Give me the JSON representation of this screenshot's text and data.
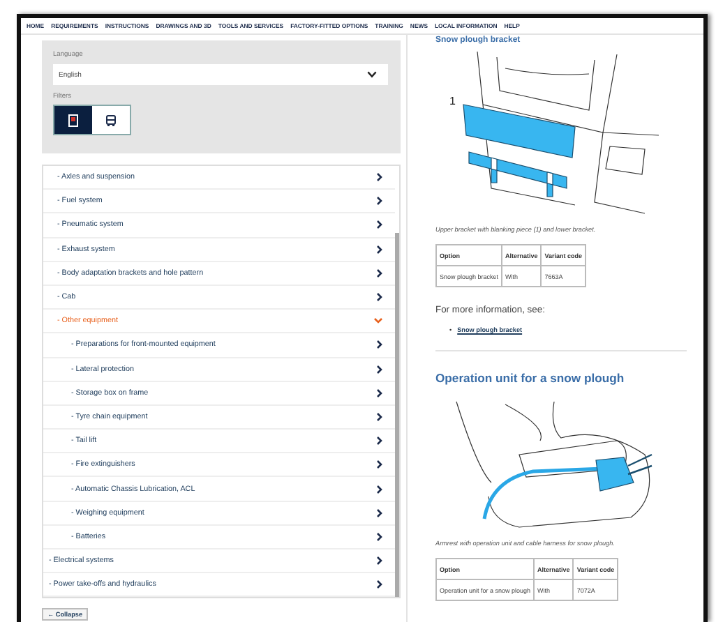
{
  "nav": [
    "HOME",
    "REQUIREMENTS",
    "INSTRUCTIONS",
    "DRAWINGS AND 3D",
    "TOOLS AND SERVICES",
    "FACTORY-FITTED OPTIONS",
    "TRAINING",
    "NEWS",
    "LOCAL INFORMATION",
    "HELP"
  ],
  "language": {
    "label": "Language",
    "value": "English"
  },
  "filters": {
    "label": "Filters",
    "items": [
      {
        "kind": "document",
        "selected": true
      },
      {
        "kind": "truck",
        "selected": false
      }
    ]
  },
  "tree": [
    {
      "label": "- Axles and suspension",
      "expanded": false
    },
    {
      "label": "- Fuel system",
      "expanded": false
    },
    {
      "label": "- Pneumatic system",
      "expanded": false
    },
    {
      "label": "- Exhaust system",
      "expanded": false
    },
    {
      "label": "- Body adaptation brackets and hole pattern",
      "expanded": false
    },
    {
      "label": "- Cab",
      "expanded": false
    },
    {
      "label": "- Other equipment",
      "expanded": true,
      "children": [
        {
          "label": "- Preparations for front-mounted equipment",
          "expanded": false
        },
        {
          "label": "- Lateral protection",
          "expanded": false
        },
        {
          "label": "- Storage box on frame",
          "expanded": false
        },
        {
          "label": "- Tyre chain equipment",
          "expanded": false
        },
        {
          "label": "- Tail lift",
          "expanded": false
        },
        {
          "label": "- Fire extinguishers",
          "expanded": false
        },
        {
          "label": "- Automatic Chassis Lubrication, ACL",
          "expanded": false
        },
        {
          "label": "- Weighing equipment",
          "expanded": false
        },
        {
          "label": "- Batteries",
          "expanded": false
        }
      ]
    }
  ],
  "tree_parent": [
    {
      "label": "- Electrical systems",
      "expanded": false
    },
    {
      "label": "- Power take-offs and hydraulics",
      "expanded": false
    }
  ],
  "collapse_button": "← Collapse",
  "sections": [
    {
      "heading": "Snow plough bracket",
      "kind": "bracket",
      "callout": "1",
      "caption": "Upper bracket with blanking piece (1) and lower bracket.",
      "table": {
        "columns": [
          "Option",
          "Alternative",
          "Variant code"
        ],
        "rows": [
          [
            "Snow plough bracket",
            "With",
            "7663A"
          ]
        ]
      },
      "more_info": "For more information, see:",
      "links": [
        {
          "marker": "•",
          "label": "Snow plough bracket"
        }
      ]
    },
    {
      "heading": "Operation unit for a snow plough",
      "kind": "armrest",
      "caption": "Armrest with operation unit and cable harness for snow plough.",
      "table": {
        "columns": [
          "Option",
          "Alternative",
          "Variant code"
        ],
        "rows": [
          [
            "Operation unit for a snow plough",
            "With",
            "7072A"
          ]
        ]
      }
    }
  ]
}
